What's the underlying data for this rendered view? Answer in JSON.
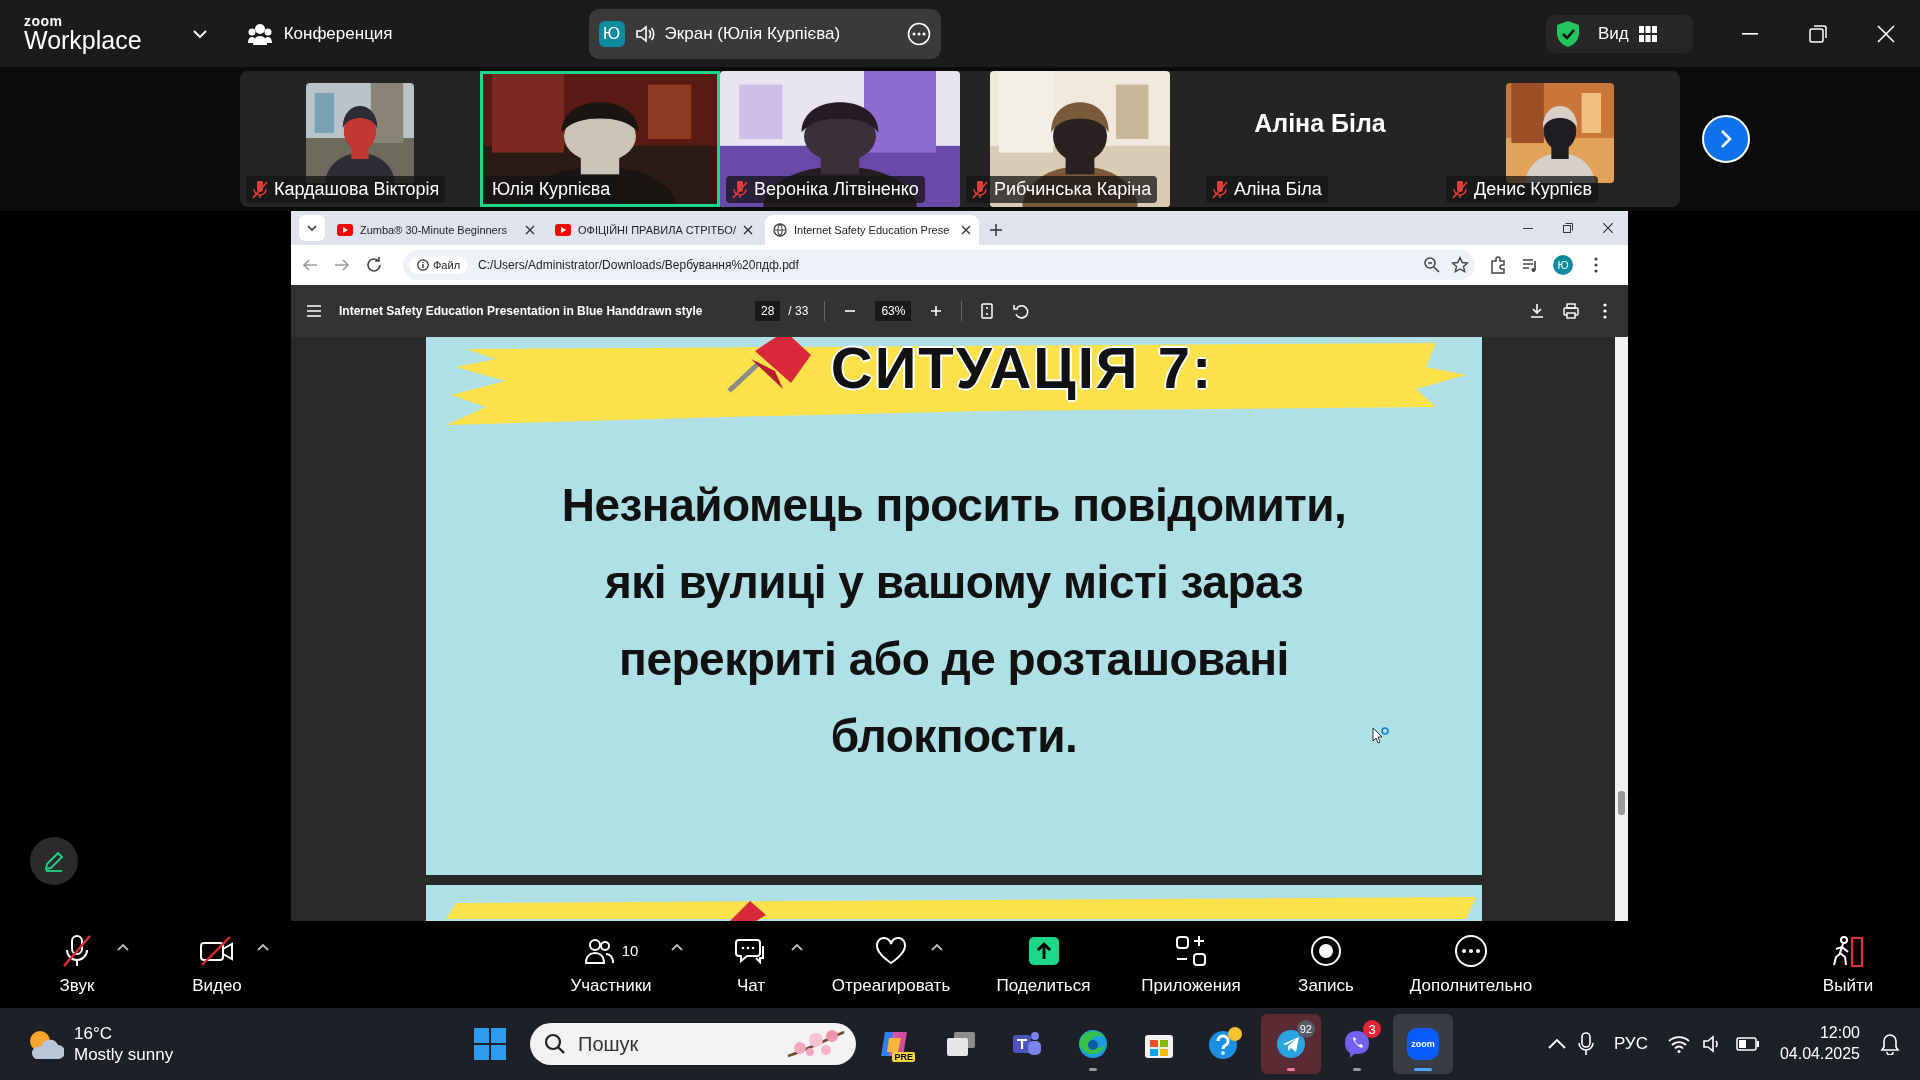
{
  "zoom_header": {
    "logo_top": "zoom",
    "logo_bottom": "Workplace",
    "meeting_button": "Конференция",
    "share_indicator": {
      "initial": "Ю",
      "label": "Экран (Юлія Курпієва)"
    },
    "view_button": "Вид"
  },
  "participants": [
    {
      "name": "Кардашова Вікторія",
      "kind": "small_video",
      "muted": true,
      "active": false
    },
    {
      "name": "Юлія Курпієва",
      "kind": "video",
      "muted": false,
      "active": true
    },
    {
      "name": "Вероніка Літвіненко",
      "kind": "video",
      "muted": true,
      "active": false
    },
    {
      "name": "Рибчинська Каріна",
      "kind": "medium_video",
      "muted": true,
      "active": false
    },
    {
      "name": "Аліна Біла",
      "kind": "name_card",
      "display_name": "Аліна Біла",
      "muted": true,
      "active": false
    },
    {
      "name": "Денис Курпієв",
      "kind": "small_video",
      "muted": true,
      "active": false
    }
  ],
  "browser": {
    "tabs": [
      {
        "title": "Zumba® 30-Minute Beginners",
        "kind": "video_site",
        "selected": false
      },
      {
        "title": "ОФІЦІЙНІ ПРАВИЛА СТРІТБО/",
        "kind": "video_site",
        "selected": false
      },
      {
        "title": "Internet Safety Education Prese",
        "kind": "web",
        "selected": true
      }
    ],
    "address": {
      "chip": "Файл",
      "url": "C:/Users/Administrator/Downloads/Вербування%20пдф.pdf"
    },
    "profile_initial": "Ю"
  },
  "pdf_viewer": {
    "title": "Internet Safety Education Presentation in Blue Handdrawn style",
    "page": "28",
    "page_count": "/ 33",
    "zoom": "63%"
  },
  "slide": {
    "heading": "СИТУАЦІЯ 7:",
    "body": "Незнайомець просить повідомити, які вулиці у вашому місті зараз перекриті або де розташовані блокпости."
  },
  "meeting_toolbar": [
    {
      "kind": "audio",
      "label": "Звук",
      "off": true,
      "caret": true
    },
    {
      "kind": "video",
      "label": "Видео",
      "off": true,
      "caret": true
    },
    {
      "kind": "participants",
      "label": "Участники",
      "count": "10",
      "caret": true
    },
    {
      "kind": "chat",
      "label": "Чат",
      "caret": true
    },
    {
      "kind": "react",
      "label": "Отреагировать",
      "caret": true
    },
    {
      "kind": "share",
      "label": "Поделиться",
      "caret": false
    },
    {
      "kind": "apps",
      "label": "Приложения",
      "caret": false
    },
    {
      "kind": "record",
      "label": "Запись",
      "caret": false
    },
    {
      "kind": "more",
      "label": "Дополнительно",
      "caret": false
    },
    {
      "kind": "leave",
      "label": "Выйти",
      "caret": false
    }
  ],
  "taskbar": {
    "weather": {
      "temperature": "16°C",
      "condition": "Mostly sunny"
    },
    "search_placeholder": "Пошук",
    "apps": [
      {
        "kind": "copilot",
        "label": "PRE",
        "running": false,
        "focused": false,
        "flashing": false
      },
      {
        "kind": "task_view",
        "running": false,
        "focused": false,
        "flashing": false
      },
      {
        "kind": "teams",
        "running": false,
        "focused": false,
        "flashing": false
      },
      {
        "kind": "edge",
        "running": true,
        "focused": false,
        "flashing": false
      },
      {
        "kind": "store",
        "running": false,
        "focused": false,
        "flashing": false
      },
      {
        "kind": "help",
        "running": false,
        "focused": false,
        "flashing": false
      },
      {
        "kind": "telegram",
        "badge": "92",
        "running": true,
        "focused": false,
        "flashing": true
      },
      {
        "kind": "viber",
        "badge": "3",
        "running": true,
        "focused": false,
        "flashing": false
      },
      {
        "kind": "zoom",
        "label": "zoom",
        "running": true,
        "focused": true,
        "flashing": false
      }
    ],
    "language": "РУС",
    "time": "12:00",
    "date": "04.04.2025"
  }
}
